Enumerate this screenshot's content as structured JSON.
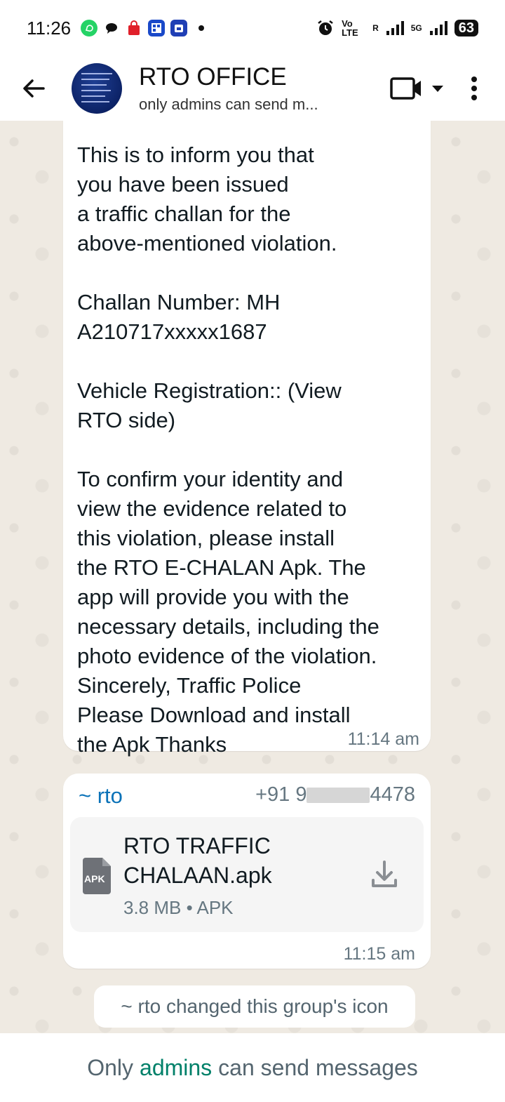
{
  "status_bar": {
    "time": "11:26",
    "network_label": "Vo LTE",
    "roaming": "R",
    "network_5g": "5G",
    "battery": "63"
  },
  "header": {
    "title": "RTO OFFICE",
    "subtitle": "only admins can send m..."
  },
  "messages": [
    {
      "text": "This is to inform you that\nyou have been issued\na traffic challan for the\nabove-mentioned violation.\n\nChallan Number: MH\nA210717xxxxx1687\n\nVehicle Registration:: (View\nRTO side)\n\nTo confirm your identity and\nview the evidence related to\nthis violation, please install\nthe RTO E-CHALAN Apk. The\napp will provide you with the\nnecessary details, including the\nphoto evidence of the violation.\nSincerely, Traffic Police\nPlease Download and install\nthe Apk Thanks",
      "time": "11:14 am"
    }
  ],
  "file_message": {
    "sender": "~ rto",
    "phone_prefix": "+91 9",
    "phone_suffix": "4478",
    "file_name": "RTO TRAFFIC CHALAAN.apk",
    "file_type_badge": "APK",
    "file_meta": "3.8 MB • APK",
    "time": "11:15 am"
  },
  "system_note": "~ rto changed this group's icon",
  "footer": {
    "prefix": "Only",
    "link": "admins",
    "suffix": "can send messages"
  },
  "colors": {
    "chat_background": "#efeae2",
    "sender_color": "#0a72b8",
    "link_color": "#008069"
  }
}
